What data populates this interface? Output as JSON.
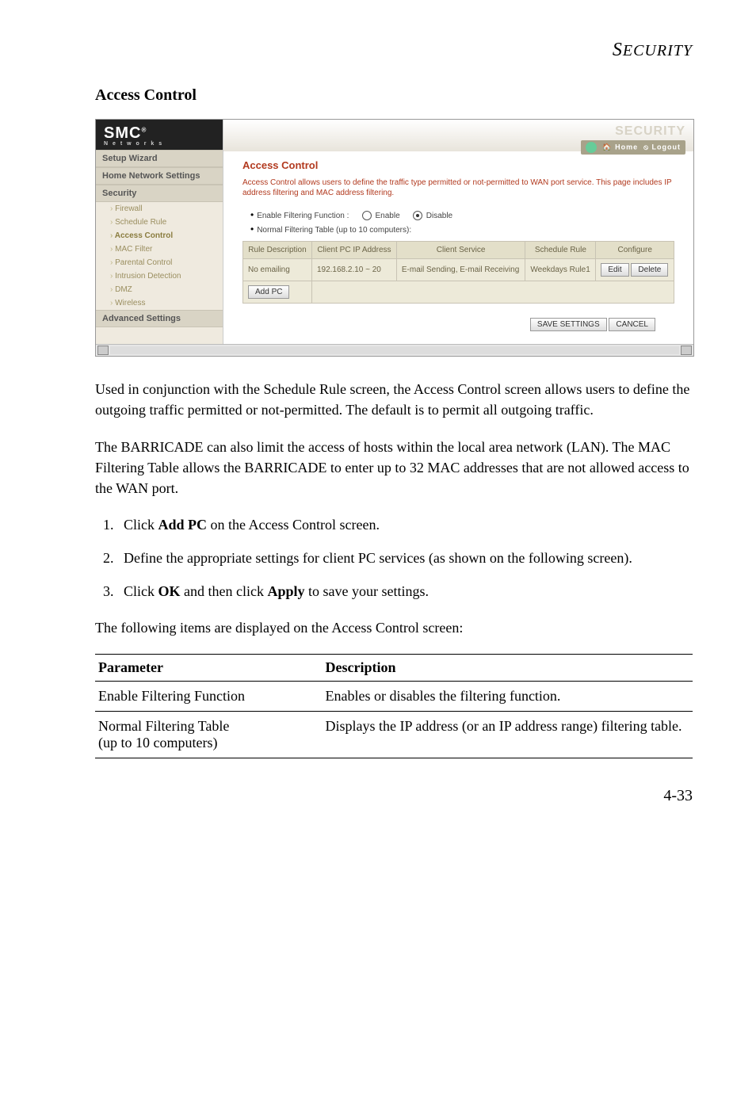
{
  "running_head": "SECURITY",
  "section_title": "Access Control",
  "screenshot": {
    "logo": "SMC",
    "logo_sub": "N e t w o r k s",
    "topbar_brand": "SECURITY",
    "top_home": "Home",
    "top_logout": "Logout",
    "nav": {
      "setup_wizard": "Setup Wizard",
      "home_network": "Home Network Settings",
      "security": "Security",
      "firewall": "Firewall",
      "schedule_rule": "Schedule Rule",
      "access_control": "Access Control",
      "mac_filter": "MAC Filter",
      "parental_control": "Parental Control",
      "intrusion": "Intrusion Detection",
      "dmz": "DMZ",
      "wireless": "Wireless",
      "advanced": "Advanced Settings"
    },
    "panel_title": "Access Control",
    "panel_desc": "Access Control allows users to define the traffic type permitted or not-permitted to WAN port service. This page includes IP address filtering and MAC address filtering.",
    "filter_label": "Enable Filtering Function :",
    "enable": "Enable",
    "disable": "Disable",
    "normal_label": "Normal Filtering Table (up to 10 computers):",
    "headers": {
      "desc": "Rule Description",
      "ip": "Client PC IP Address",
      "service": "Client Service",
      "schedule": "Schedule Rule",
      "configure": "Configure"
    },
    "row": {
      "desc": "No emailing",
      "ip": "192.168.2.10 ~ 20",
      "service": "E-mail Sending, E-mail Receiving",
      "schedule": "Weekdays Rule1",
      "edit": "Edit",
      "delete": "Delete"
    },
    "add_pc": "Add PC",
    "save": "SAVE SETTINGS",
    "cancel": "CANCEL"
  },
  "para1": "Used in conjunction with the Schedule Rule screen, the Access Control screen allows users to define the outgoing traffic permitted or not-permitted. The default is to permit all outgoing traffic.",
  "para2": "The BARRICADE can also limit the access of hosts within the local area network (LAN). The MAC Filtering Table allows the BARRICADE to enter up to 32 MAC addresses that are not allowed access to the WAN port.",
  "steps": [
    {
      "pre": "Click ",
      "bold": "Add PC",
      "post": " on the Access Control screen."
    },
    {
      "pre": "Define the appropriate settings for client PC services (as shown on the following screen).",
      "bold": "",
      "post": ""
    },
    {
      "pre": "Click ",
      "bold": "OK",
      "mid": " and then click ",
      "bold2": "Apply",
      "post": " to save your settings."
    }
  ],
  "para3": "The following items are displayed on the Access Control screen:",
  "table": {
    "h1": "Parameter",
    "h2": "Description",
    "r1c1": "Enable Filtering Function",
    "r1c2": "Enables or disables the filtering function.",
    "r2c1a": "Normal Filtering Table",
    "r2c1b": "(up to 10 computers)",
    "r2c2": "Displays the IP address (or an IP address range) filtering table."
  },
  "page_num": "4-33"
}
